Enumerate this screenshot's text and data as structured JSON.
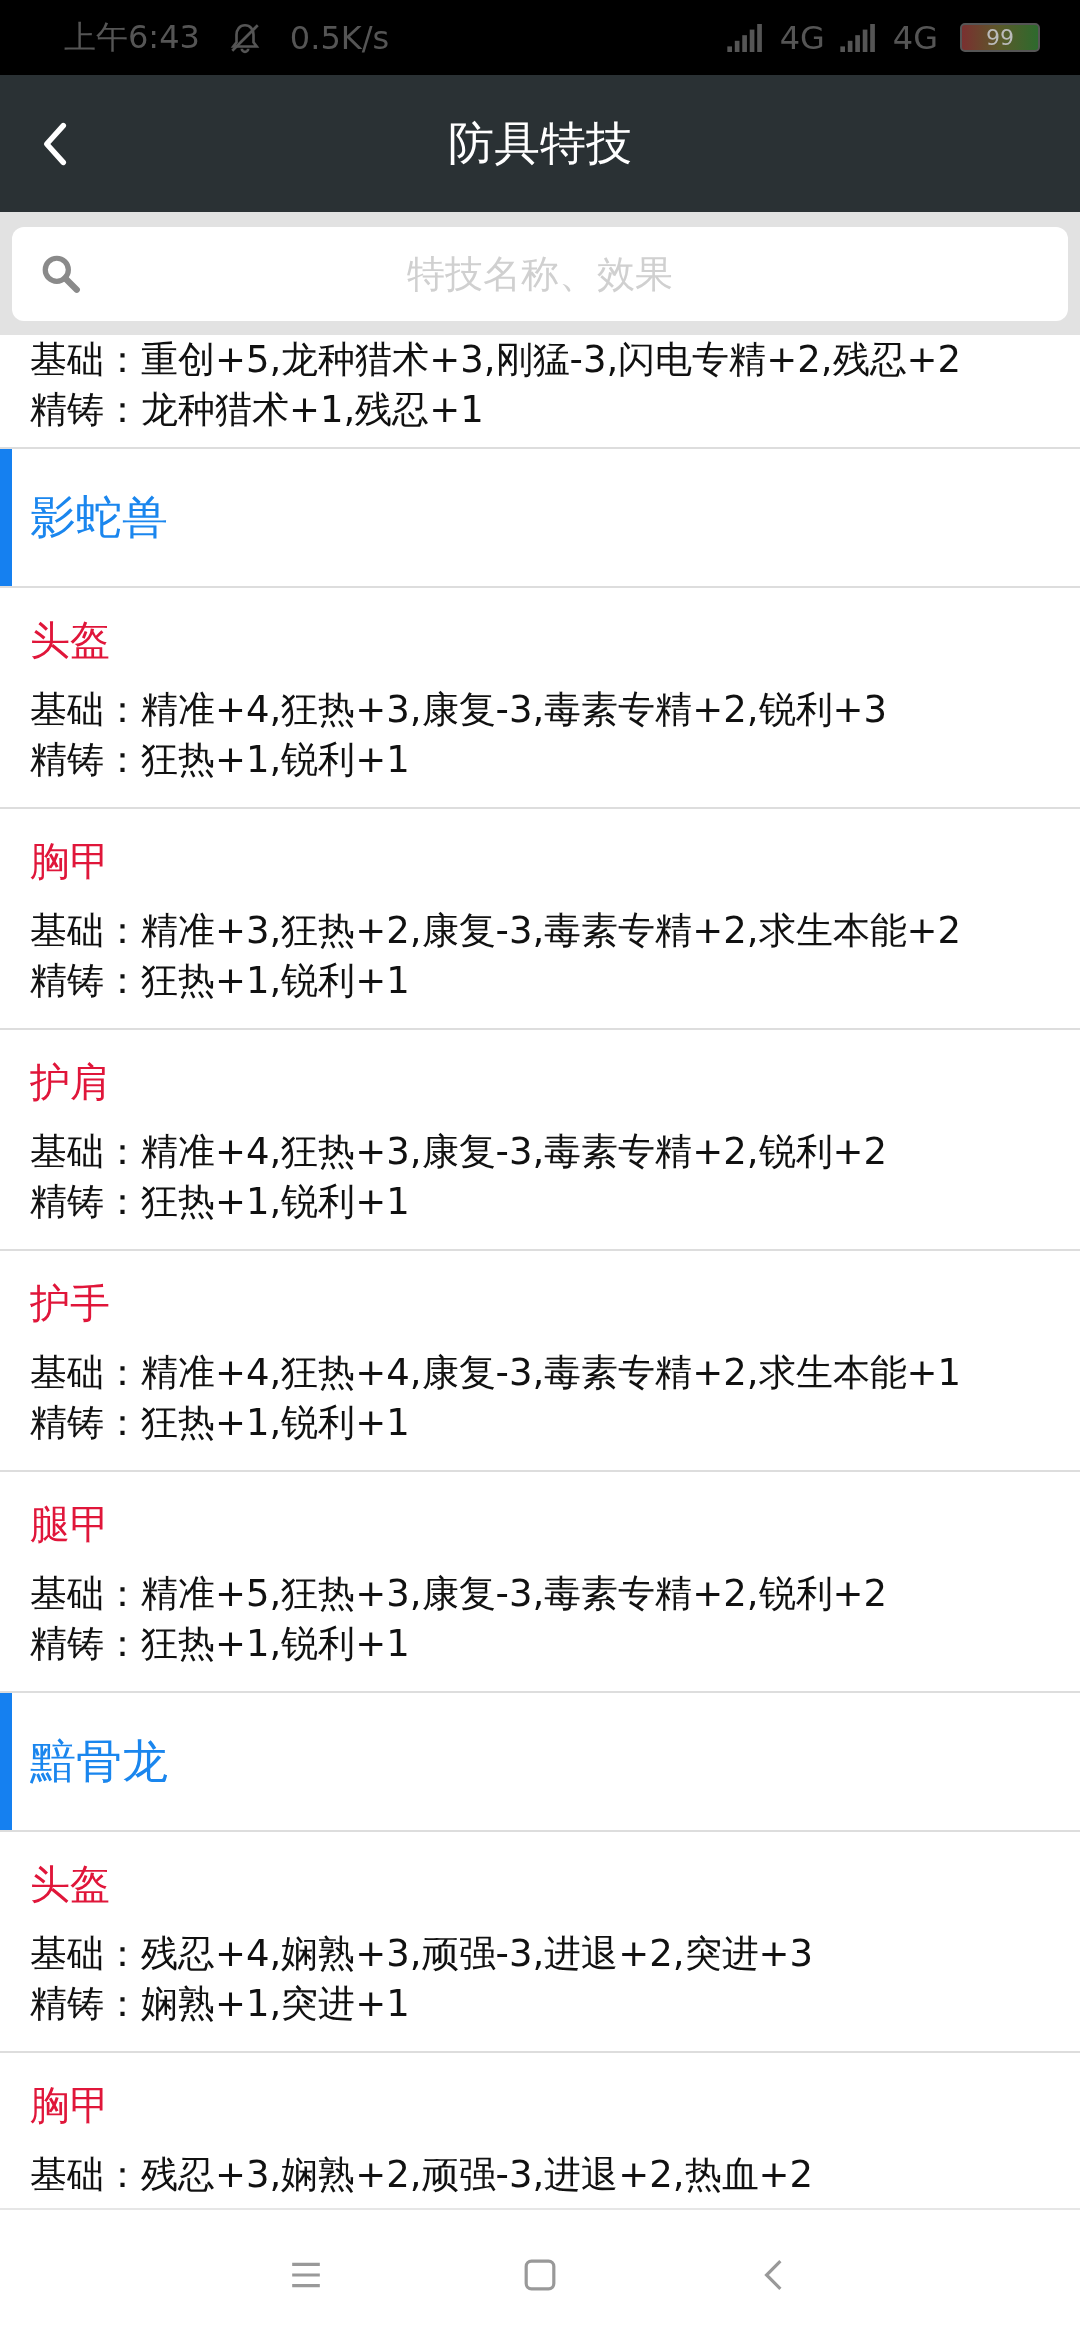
{
  "status_bar": {
    "time": "上午6:43",
    "speed": "0.5K/s",
    "network_1": "4G",
    "network_2": "4G",
    "battery": "99"
  },
  "header": {
    "title": "防具特技"
  },
  "search": {
    "placeholder": "特技名称、效果"
  },
  "entries": [
    {
      "kind": "item",
      "base": "基础：重创+5,龙种猎术+3,刚猛-3,闪电专精+2,残忍+2",
      "refine": "精铸：龙种猎术+1,残忍+1"
    },
    {
      "kind": "group",
      "name": "影蛇兽"
    },
    {
      "kind": "item",
      "title": "头盔",
      "base": "基础：精准+4,狂热+3,康复-3,毒素专精+2,锐利+3",
      "refine": "精铸：狂热+1,锐利+1"
    },
    {
      "kind": "item",
      "title": "胸甲",
      "base": "基础：精准+3,狂热+2,康复-3,毒素专精+2,求生本能+2",
      "refine": "精铸：狂热+1,锐利+1"
    },
    {
      "kind": "item",
      "title": "护肩",
      "base": "基础：精准+4,狂热+3,康复-3,毒素专精+2,锐利+2",
      "refine": "精铸：狂热+1,锐利+1"
    },
    {
      "kind": "item",
      "title": "护手",
      "base": "基础：精准+4,狂热+4,康复-3,毒素专精+2,求生本能+1",
      "refine": "精铸：狂热+1,锐利+1"
    },
    {
      "kind": "item",
      "title": "腿甲",
      "base": "基础：精准+5,狂热+3,康复-3,毒素专精+2,锐利+2",
      "refine": "精铸：狂热+1,锐利+1"
    },
    {
      "kind": "group",
      "name": "黯骨龙"
    },
    {
      "kind": "item",
      "title": "头盔",
      "base": "基础：残忍+4,娴熟+3,顽强-3,进退+2,突进+3",
      "refine": "精铸：娴熟+1,突进+1"
    },
    {
      "kind": "item",
      "title": "胸甲",
      "base": "基础：残忍+3,娴熟+2,顽强-3,进退+2,热血+2"
    }
  ]
}
